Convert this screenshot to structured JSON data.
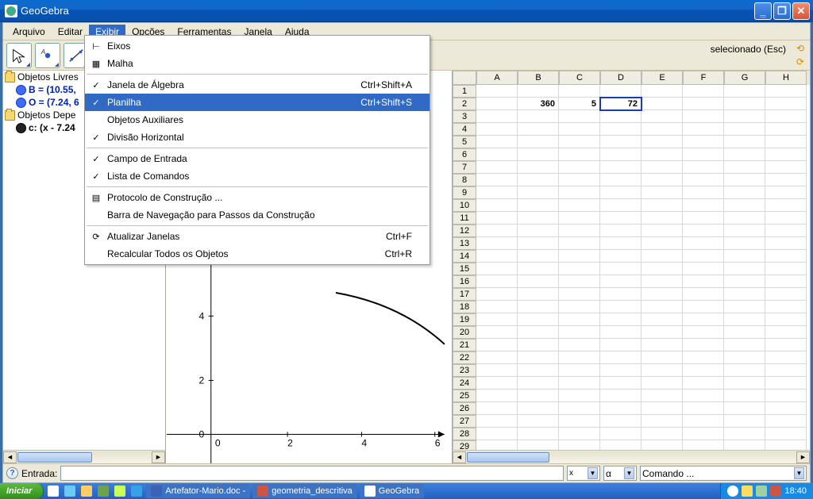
{
  "titlebar": {
    "title": "GeoGebra"
  },
  "menubar": {
    "items": [
      "Arquivo",
      "Editar",
      "Exibir",
      "Opções",
      "Ferramentas",
      "Janela",
      "Ajuda"
    ],
    "active_index": 2
  },
  "toolbar": {
    "hint_end": "selecionado (Esc)"
  },
  "dropdown": {
    "items": [
      {
        "check": "",
        "label": "Eixos",
        "shortcut": ""
      },
      {
        "check": "",
        "label": "Malha",
        "shortcut": ""
      },
      {
        "sep": true
      },
      {
        "check": "✓",
        "label": "Janela de Álgebra",
        "shortcut": "Ctrl+Shift+A"
      },
      {
        "check": "✓",
        "label": "Planilha",
        "shortcut": "Ctrl+Shift+S",
        "highlight": true
      },
      {
        "check": "",
        "label": "Objetos Auxiliares",
        "shortcut": ""
      },
      {
        "check": "✓",
        "label": "Divisão Horizontal",
        "shortcut": ""
      },
      {
        "sep": true
      },
      {
        "check": "✓",
        "label": "Campo de Entrada",
        "shortcut": ""
      },
      {
        "check": "✓",
        "label": "Lista de Comandos",
        "shortcut": ""
      },
      {
        "sep": true
      },
      {
        "check": "",
        "label": "Protocolo de Construção ...",
        "shortcut": "",
        "icon": "list"
      },
      {
        "check": "",
        "label": "Barra de Navegação para Passos da Construção",
        "shortcut": ""
      },
      {
        "sep": true
      },
      {
        "check": "",
        "label": "Atualizar Janelas",
        "shortcut": "Ctrl+F",
        "icon": "refresh"
      },
      {
        "check": "",
        "label": "Recalcular Todos os Objetos",
        "shortcut": "Ctrl+R"
      }
    ]
  },
  "algebra": {
    "free_label": "Objetos Livres",
    "dep_label": "Objetos Depe",
    "free_items": [
      "B = (10.55,",
      "O = (7.24, 6"
    ],
    "dep_items": [
      "c: (x - 7.24"
    ]
  },
  "graphics": {
    "x_ticks": [
      "0",
      "2",
      "4",
      "6"
    ],
    "y_ticks": [
      "0",
      "2",
      "4"
    ]
  },
  "spreadsheet": {
    "columns": [
      "A",
      "B",
      "C",
      "D",
      "E",
      "F",
      "G",
      "H"
    ],
    "rows_start": 17,
    "rows_end": 29,
    "selected": "D2",
    "cells": {
      "B2": "360",
      "C2": "5",
      "D2": "72"
    }
  },
  "inputbar": {
    "label": "Entrada:",
    "combo1": "x",
    "combo2": "α",
    "combo3": "Comando ..."
  },
  "taskbar": {
    "start": "Iniciar",
    "items": [
      "Artefator-Mario.doc -",
      "geometria_descritiva",
      "GeoGebra"
    ],
    "clock": "18:40"
  }
}
